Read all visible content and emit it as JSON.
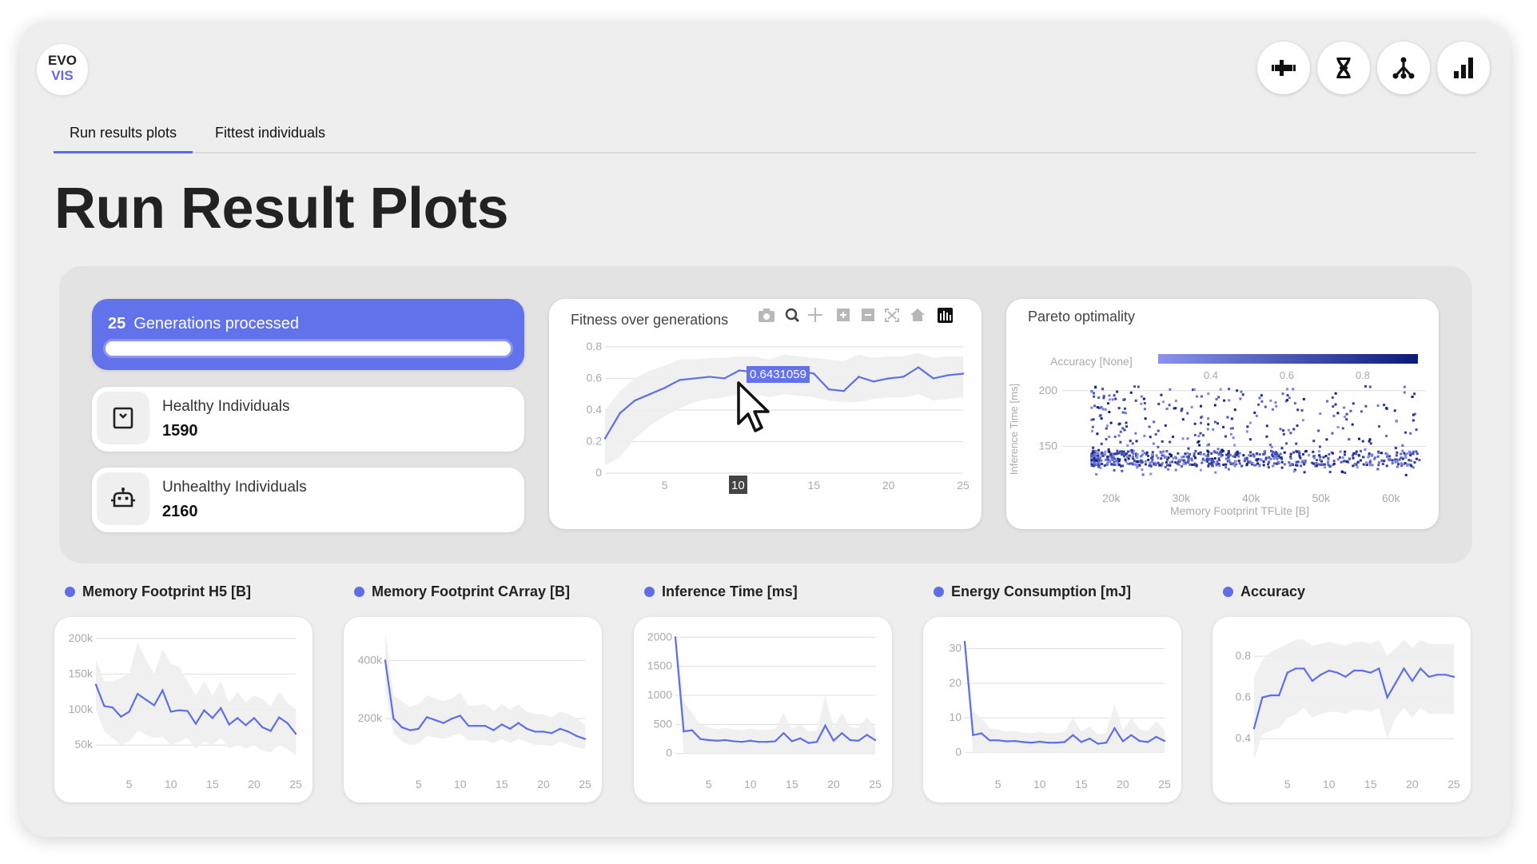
{
  "app": {
    "logo_line1": "EVO",
    "logo_line2": "VIS"
  },
  "toolbar_icons": [
    "genome-scale-icon",
    "dna-icon",
    "tree-icon",
    "bar-chart-icon"
  ],
  "tabs": [
    {
      "label": "Run results plots",
      "active": true
    },
    {
      "label": "Fittest individuals",
      "active": false
    }
  ],
  "page_title": "Run Result Plots",
  "stats": {
    "generations": {
      "count": "25",
      "label": "Generations processed",
      "progress": 1.0
    },
    "healthy": {
      "label": "Healthy Individuals",
      "value": "1590"
    },
    "unhealthy": {
      "label": "Unhealthy Individuals",
      "value": "2160"
    }
  },
  "fitness_chart": {
    "title": "Fitness over generations",
    "hover_value": "0.6431059",
    "hover_x": "10",
    "modebar": [
      "camera-icon",
      "zoom-icon",
      "pan-icon",
      "zoom-in-icon",
      "zoom-out-icon",
      "autoscale-icon",
      "home-icon",
      "plotly-logo-icon"
    ]
  },
  "pareto_chart": {
    "title": "Pareto optimality",
    "colorbar_label": "Accuracy [None]",
    "colorbar_ticks": [
      "0.4",
      "0.6",
      "0.8"
    ]
  },
  "small_charts": [
    {
      "title": "Memory Footprint H5 [B]"
    },
    {
      "title": "Memory Footprint CArray [B]"
    },
    {
      "title": "Inference Time [ms]"
    },
    {
      "title": "Energy Consumption [mJ]"
    },
    {
      "title": "Accuracy"
    }
  ],
  "colors": {
    "accent": "#6172ea",
    "line": "#5e6ee6",
    "band": "#eeeeee",
    "scatter_dark": "#0a1a7a",
    "scatter_light": "#8a93f0"
  },
  "chart_data": [
    {
      "type": "line",
      "title": "Fitness over generations",
      "x": [
        1,
        2,
        3,
        4,
        5,
        6,
        7,
        8,
        9,
        10,
        11,
        12,
        13,
        14,
        15,
        16,
        17,
        18,
        19,
        20,
        21,
        22,
        23,
        24,
        25
      ],
      "series": [
        {
          "values": [
            0.22,
            0.38,
            0.46,
            0.5,
            0.54,
            0.59,
            0.6,
            0.61,
            0.6,
            0.65,
            0.64,
            0.62,
            0.67,
            0.65,
            0.63,
            0.53,
            0.52,
            0.61,
            0.58,
            0.6,
            0.61,
            0.67,
            0.6,
            0.62,
            0.63
          ]
        }
      ],
      "band_low": [
        0.05,
        0.1,
        0.22,
        0.3,
        0.36,
        0.41,
        0.45,
        0.47,
        0.48,
        0.5,
        0.5,
        0.48,
        0.5,
        0.49,
        0.48,
        0.46,
        0.45,
        0.45,
        0.47,
        0.48,
        0.48,
        0.5,
        0.46,
        0.47,
        0.48
      ],
      "band_high": [
        0.4,
        0.52,
        0.6,
        0.65,
        0.68,
        0.72,
        0.72,
        0.73,
        0.73,
        0.74,
        0.74,
        0.72,
        0.75,
        0.74,
        0.73,
        0.72,
        0.71,
        0.75,
        0.73,
        0.74,
        0.74,
        0.76,
        0.73,
        0.74,
        0.74
      ],
      "xticks": [
        5,
        10,
        15,
        20,
        25
      ],
      "yticks": [
        "0",
        "0.2",
        "0.4",
        "0.6",
        "0.8"
      ],
      "xlim": [
        1,
        25
      ],
      "ylim": [
        0,
        0.85
      ]
    },
    {
      "type": "scatter",
      "title": "Pareto optimality",
      "xlabel": "Memory Footprint TFLite [B]",
      "ylabel": "Inference Time [ms]",
      "xticks": [
        "20k",
        "30k",
        "40k",
        "50k",
        "60k"
      ],
      "yticks": [
        "150",
        "200"
      ],
      "xlim": [
        13000,
        65000
      ],
      "ylim": [
        115,
        225
      ],
      "colorscale_label": "Accuracy [None]"
    },
    {
      "type": "line",
      "title": "Memory Footprint H5 [B]",
      "x": [
        1,
        2,
        3,
        4,
        5,
        6,
        7,
        8,
        9,
        10,
        11,
        12,
        13,
        14,
        15,
        16,
        17,
        18,
        19,
        20,
        21,
        22,
        23,
        24,
        25
      ],
      "series": [
        {
          "values": [
            135000,
            105000,
            103000,
            90000,
            97000,
            122000,
            114000,
            106000,
            127000,
            97000,
            99000,
            98000,
            80000,
            99000,
            88000,
            102000,
            79000,
            88000,
            78000,
            88000,
            75000,
            70000,
            89000,
            81000,
            66000
          ]
        }
      ],
      "band_low": [
        100000,
        70000,
        60000,
        50000,
        55000,
        70000,
        65000,
        60000,
        62000,
        50000,
        55000,
        60000,
        45000,
        55000,
        50000,
        60000,
        45000,
        50000,
        45000,
        50000,
        42000,
        40000,
        50000,
        45000,
        35000
      ],
      "band_high": [
        170000,
        140000,
        140000,
        145000,
        150000,
        195000,
        170000,
        150000,
        185000,
        165000,
        160000,
        140000,
        120000,
        140000,
        120000,
        140000,
        110000,
        125000,
        110000,
        120000,
        115000,
        105000,
        125000,
        110000,
        100000
      ],
      "xticks": [
        5,
        10,
        15,
        20,
        25
      ],
      "yticks": [
        "50k",
        "100k",
        "150k",
        "200k"
      ],
      "ylim": [
        30000,
        210000
      ]
    },
    {
      "type": "line",
      "title": "Memory Footprint CArray [B]",
      "x": [
        1,
        2,
        3,
        4,
        5,
        6,
        7,
        8,
        9,
        10,
        11,
        12,
        13,
        14,
        15,
        16,
        17,
        18,
        19,
        20,
        21,
        22,
        23,
        24,
        25
      ],
      "series": [
        {
          "values": [
            400000,
            200000,
            170000,
            160000,
            165000,
            205000,
            195000,
            185000,
            200000,
            210000,
            175000,
            175000,
            175000,
            160000,
            180000,
            165000,
            185000,
            165000,
            155000,
            155000,
            150000,
            165000,
            155000,
            140000,
            130000
          ]
        }
      ],
      "band_low": [
        300000,
        150000,
        120000,
        110000,
        115000,
        140000,
        135000,
        130000,
        140000,
        150000,
        125000,
        125000,
        125000,
        115000,
        130000,
        115000,
        130000,
        120000,
        110000,
        110000,
        105000,
        120000,
        110000,
        100000,
        95000
      ],
      "band_high": [
        500000,
        280000,
        260000,
        240000,
        250000,
        280000,
        270000,
        260000,
        270000,
        290000,
        245000,
        245000,
        250000,
        225000,
        250000,
        230000,
        250000,
        225000,
        215000,
        215000,
        205000,
        225000,
        215000,
        200000,
        180000
      ],
      "xticks": [
        5,
        10,
        15,
        20,
        25
      ],
      "yticks": [
        "200k",
        "400k"
      ],
      "ylim": [
        60000,
        500000
      ]
    },
    {
      "type": "line",
      "title": "Inference Time [ms]",
      "x": [
        1,
        2,
        3,
        4,
        5,
        6,
        7,
        8,
        9,
        10,
        11,
        12,
        13,
        14,
        15,
        16,
        17,
        18,
        19,
        20,
        21,
        22,
        23,
        24,
        25
      ],
      "series": [
        {
          "values": [
            2000,
            380,
            400,
            250,
            230,
            220,
            230,
            210,
            200,
            220,
            200,
            200,
            210,
            350,
            210,
            260,
            180,
            200,
            480,
            220,
            350,
            230,
            220,
            320,
            230
          ]
        }
      ],
      "band_low": [
        1800,
        0,
        0,
        0,
        0,
        0,
        0,
        0,
        0,
        0,
        0,
        0,
        0,
        0,
        0,
        0,
        0,
        0,
        0,
        0,
        0,
        0,
        0,
        0,
        0
      ],
      "band_high": [
        2100,
        900,
        700,
        500,
        450,
        420,
        440,
        410,
        400,
        430,
        400,
        410,
        420,
        700,
        420,
        520,
        380,
        400,
        1000,
        440,
        700,
        460,
        440,
        620,
        450
      ],
      "xticks": [
        5,
        10,
        15,
        20,
        25
      ],
      "yticks": [
        "0",
        "500",
        "1000",
        "1500",
        "2000"
      ],
      "ylim": [
        -100,
        2100
      ]
    },
    {
      "type": "line",
      "title": "Energy Consumption [mJ]",
      "x": [
        1,
        2,
        3,
        4,
        5,
        6,
        7,
        8,
        9,
        10,
        11,
        12,
        13,
        14,
        15,
        16,
        17,
        18,
        19,
        20,
        21,
        22,
        23,
        24,
        25
      ],
      "series": [
        {
          "values": [
            32,
            5,
            5.5,
            3.5,
            3.5,
            3.2,
            3.3,
            3,
            2.8,
            3.1,
            2.8,
            2.8,
            3,
            5,
            3,
            4,
            2.5,
            2.8,
            7,
            3.2,
            5,
            3.3,
            3,
            4.5,
            3.3
          ]
        }
      ],
      "band_low": [
        30,
        0,
        0,
        0,
        0,
        0,
        0,
        0,
        0,
        0,
        0,
        0,
        0,
        0,
        0,
        0,
        0,
        0,
        0,
        0,
        0,
        0,
        0,
        0,
        0
      ],
      "band_high": [
        33,
        12,
        10,
        7,
        6.5,
        6,
        6.2,
        5.8,
        5.5,
        6,
        5.5,
        5.6,
        6,
        10,
        6,
        7.5,
        5.2,
        5.6,
        14,
        6.4,
        10,
        6.6,
        6.2,
        9,
        6.5
      ],
      "xticks": [
        5,
        10,
        15,
        20,
        25
      ],
      "yticks": [
        "0",
        "10",
        "20",
        "30"
      ],
      "ylim": [
        -2,
        35
      ]
    },
    {
      "type": "line",
      "title": "Accuracy",
      "x": [
        1,
        2,
        3,
        4,
        5,
        6,
        7,
        8,
        9,
        10,
        11,
        12,
        13,
        14,
        15,
        16,
        17,
        18,
        19,
        20,
        21,
        22,
        23,
        24,
        25
      ],
      "series": [
        {
          "values": [
            0.45,
            0.6,
            0.61,
            0.61,
            0.72,
            0.74,
            0.74,
            0.68,
            0.71,
            0.73,
            0.72,
            0.7,
            0.73,
            0.73,
            0.72,
            0.74,
            0.6,
            0.67,
            0.74,
            0.68,
            0.74,
            0.7,
            0.71,
            0.71,
            0.7
          ]
        }
      ],
      "band_low": [
        0.3,
        0.42,
        0.44,
        0.45,
        0.5,
        0.52,
        0.55,
        0.5,
        0.52,
        0.53,
        0.53,
        0.52,
        0.54,
        0.54,
        0.53,
        0.55,
        0.4,
        0.5,
        0.55,
        0.5,
        0.55,
        0.52,
        0.52,
        0.52,
        0.52
      ],
      "band_high": [
        0.7,
        0.78,
        0.82,
        0.84,
        0.86,
        0.88,
        0.88,
        0.85,
        0.86,
        0.87,
        0.86,
        0.85,
        0.87,
        0.87,
        0.86,
        0.88,
        0.8,
        0.84,
        0.88,
        0.84,
        0.88,
        0.86,
        0.86,
        0.86,
        0.86
      ],
      "xticks": [
        5,
        10,
        15,
        20,
        25
      ],
      "yticks": [
        "0.4",
        "0.6",
        "0.8"
      ],
      "ylim": [
        0.3,
        0.92
      ]
    }
  ]
}
